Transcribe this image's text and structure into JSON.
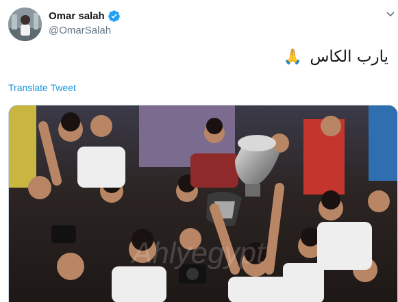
{
  "tweet": {
    "author": {
      "display_name": "Omar salah",
      "handle": "@OmarSalah",
      "verified": true,
      "avatar_icon": "profile-avatar"
    },
    "text": "يارب الكاس",
    "emoji": "🙏",
    "translate_label": "Translate Tweet",
    "media": {
      "type": "photo",
      "watermark": "Ahlyegypt"
    }
  },
  "colors": {
    "link": "#1b95e0",
    "verified": "#1da1f2",
    "handle": "#657786",
    "text": "#14171a"
  }
}
